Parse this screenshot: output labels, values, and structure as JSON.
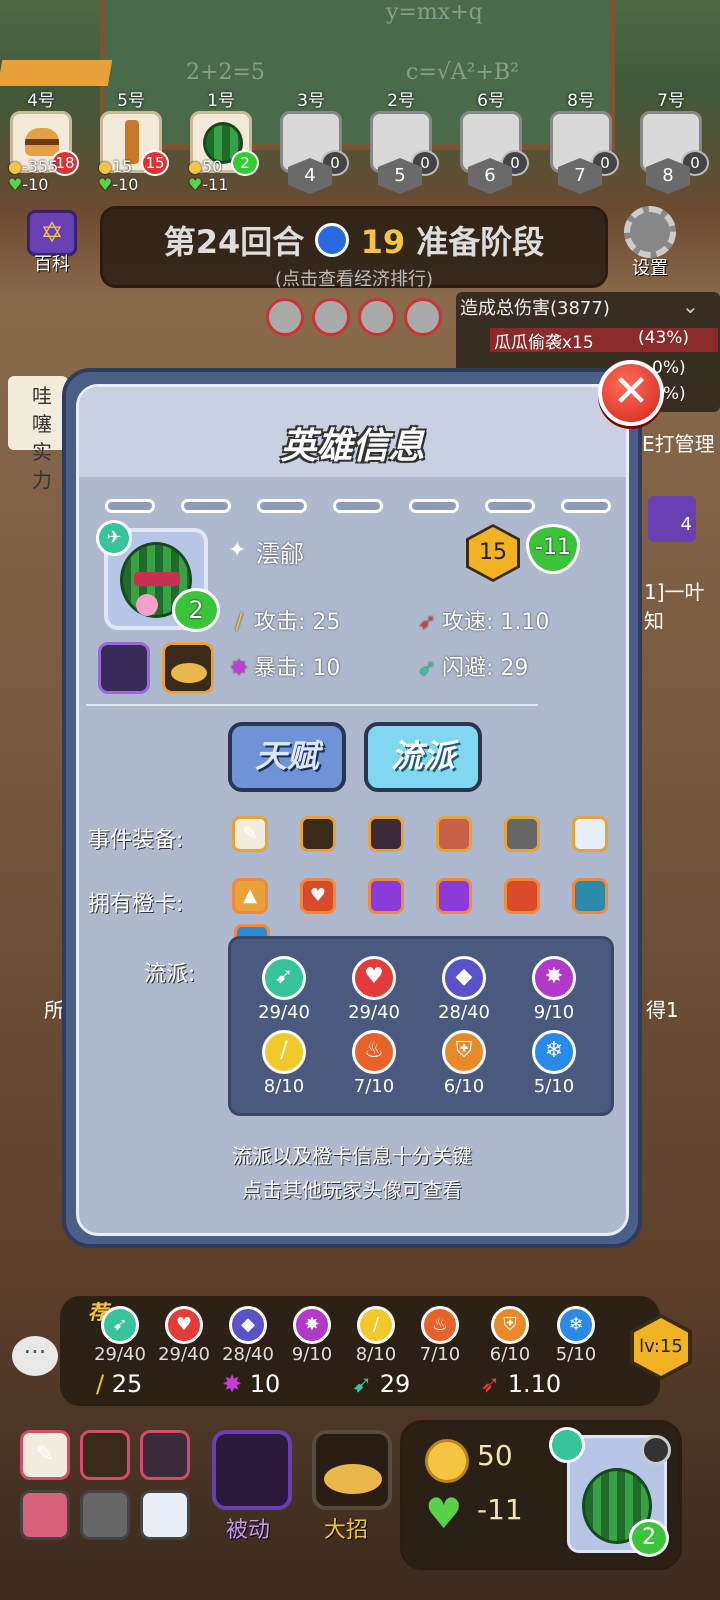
{
  "players": [
    {
      "slot": "4号",
      "hp": "18",
      "gold": "-355",
      "life": "-10"
    },
    {
      "slot": "5号",
      "hp": "15",
      "gold": "15",
      "life": "-10"
    },
    {
      "slot": "1号",
      "hp": "2",
      "gold": "50",
      "life": "-11"
    },
    {
      "slot": "3号",
      "hp": "0"
    },
    {
      "slot": "2号",
      "hp": "0"
    },
    {
      "slot": "6号",
      "hp": "0"
    },
    {
      "slot": "8号",
      "hp": "0"
    },
    {
      "slot": "7号",
      "hp": "0"
    }
  ],
  "rank_slots": [
    "4",
    "5",
    "6",
    "7",
    "8"
  ],
  "wiki_label": "百科",
  "settings_label": "设置",
  "round": {
    "title": "第24回合",
    "timer": "19",
    "phase": "准备阶段",
    "subtitle": "(点击查看经济排行)"
  },
  "damage": {
    "header": "造成总伤害(3877)",
    "row1_name": "瓜瓜偷袭x15",
    "row1_pct": "(43%)",
    "row2_pct": "0%)",
    "row3_pct": "5%)"
  },
  "side_text": {
    "left1": "哇噻",
    "left2": "实力",
    "right1": "E打管理",
    "right2": "1]一叶知",
    "right_num": "4",
    "right3": "得1",
    "left3": "所"
  },
  "modal": {
    "title": "英雄信息",
    "hero_name": "澐鄃",
    "level": "15",
    "life": "-11",
    "hero_hp": "2",
    "attack_label": "攻击:",
    "attack": "25",
    "speed_label": "攻速:",
    "speed": "1.10",
    "crit_label": "暴击:",
    "crit": "10",
    "dodge_label": "闪避:",
    "dodge": "29",
    "talent_btn": "天赋",
    "school_btn": "流派",
    "equip_label": "事件装备:",
    "cards_label": "拥有橙卡:",
    "school_label": "流派:",
    "schools": [
      {
        "icon": "wing-icon",
        "value": "29/40",
        "color": "#38c49a"
      },
      {
        "icon": "heart-icon",
        "value": "29/40",
        "color": "#e43b3b"
      },
      {
        "icon": "mask-icon",
        "value": "28/40",
        "color": "#5a52c8"
      },
      {
        "icon": "burst-icon",
        "value": "9/10",
        "color": "#b13bc8"
      },
      {
        "icon": "sword-icon",
        "value": "8/10",
        "color": "#f2c92a"
      },
      {
        "icon": "fire-icon",
        "value": "7/10",
        "color": "#e8632a"
      },
      {
        "icon": "shield-icon",
        "value": "6/10",
        "color": "#e88a2a"
      },
      {
        "icon": "snowflake-icon",
        "value": "5/10",
        "color": "#2a8ae8"
      }
    ],
    "hint1": "流派以及橙卡信息十分关键",
    "hint2": "点击其他玩家头像可查看"
  },
  "bottom": {
    "recommend": "荐",
    "schools": [
      "29/40",
      "29/40",
      "28/40",
      "9/10",
      "8/10",
      "7/10",
      "6/10",
      "5/10"
    ],
    "attack": "25",
    "crit": "10",
    "dodge": "29",
    "speed": "1.10",
    "level": "lv:15",
    "passive_label": "被动",
    "ult_label": "大招",
    "gold": "50",
    "life": "-11",
    "hero_hp": "2"
  }
}
